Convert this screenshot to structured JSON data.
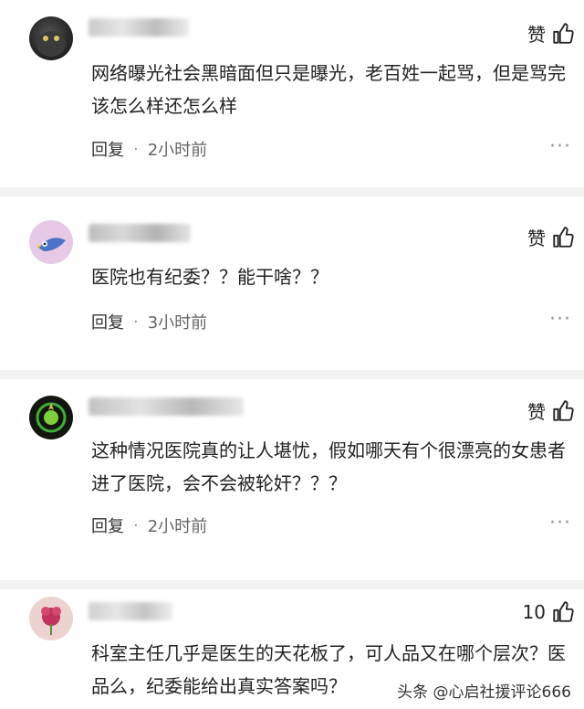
{
  "comments": [
    {
      "like_label": "赞",
      "text": "网络曝光社会黑暗面但只是曝光，老百姓一起骂，但是骂完该怎么样还怎么样",
      "reply_label": "回复",
      "time": "2小时前"
    },
    {
      "like_label": "赞",
      "text": "医院也有纪委？？能干啥？？",
      "reply_label": "回复",
      "time": "3小时前"
    },
    {
      "like_label": "赞",
      "text": "这种情况医院真的让人堪忧，假如哪天有个很漂亮的女患者进了医院，会不会被轮奸？？？",
      "reply_label": "回复",
      "time": "2小时前"
    },
    {
      "like_label": "10",
      "text": "科室主任几乎是医生的天花板了，可人品又在哪个层次？医品么，纪委能给出真实答案吗？",
      "reply_label": "",
      "time": ""
    }
  ],
  "watermark": "头条 @心启社援评论666",
  "colors": {
    "separator": "#f2f2f2",
    "text": "#222222",
    "meta": "#666666"
  }
}
